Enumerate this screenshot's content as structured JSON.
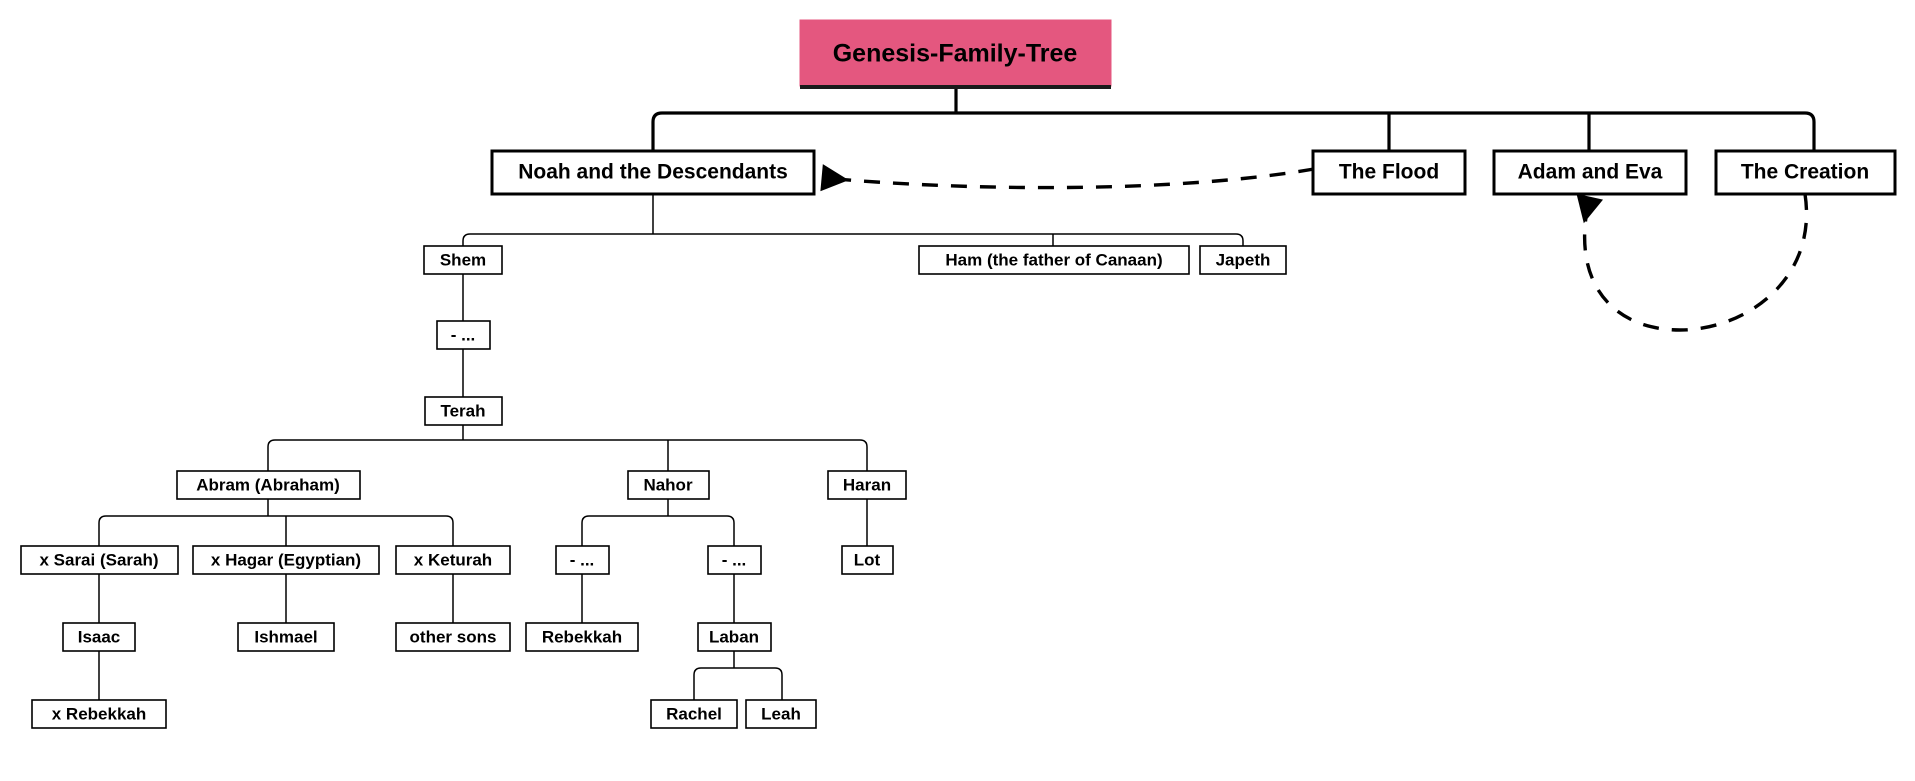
{
  "diagram": {
    "type": "family-tree",
    "title": "Genesis-Family-Tree",
    "background_color": "#ffffff",
    "title_fill_color": "#e4577f",
    "node_fill_color": "#ffffff",
    "node_stroke_color": "#000000",
    "nodes": {
      "root": "Genesis-Family-Tree",
      "noah": "Noah and the Descendants",
      "flood": "The Flood",
      "adam": "Adam and Eva",
      "creation": "The Creation",
      "shem": "Shem",
      "ham": "Ham (the father of Canaan)",
      "japeth": "Japeth",
      "shem_ellipsis": "- ...",
      "terah": "Terah",
      "abram": "Abram (Abraham)",
      "nahor": "Nahor",
      "haran": "Haran",
      "sarai": "x Sarai (Sarah)",
      "hagar": "x Hagar (Egyptian)",
      "keturah": "x Keturah",
      "nahor_ellipsis_1": "- ...",
      "nahor_ellipsis_2": "- ...",
      "lot": "Lot",
      "isaac": "Isaac",
      "ishmael": "Ishmael",
      "other_sons": "other sons",
      "rebekkah": "Rebekkah",
      "laban": "Laban",
      "x_rebekkah": "x Rebekkah",
      "rachel": "Rachel",
      "leah": "Leah"
    },
    "relations": [
      {
        "from": "root",
        "to": "noah",
        "style": "solid"
      },
      {
        "from": "root",
        "to": "flood",
        "style": "solid"
      },
      {
        "from": "root",
        "to": "adam",
        "style": "solid"
      },
      {
        "from": "root",
        "to": "creation",
        "style": "solid"
      },
      {
        "from": "flood",
        "to": "noah",
        "style": "dashed-arrow"
      },
      {
        "from": "creation",
        "to": "adam",
        "style": "dashed-arrow"
      },
      {
        "from": "noah",
        "to": "shem",
        "style": "solid"
      },
      {
        "from": "noah",
        "to": "ham",
        "style": "solid"
      },
      {
        "from": "noah",
        "to": "japeth",
        "style": "solid"
      },
      {
        "from": "shem",
        "to": "shem_ellipsis",
        "style": "solid"
      },
      {
        "from": "shem_ellipsis",
        "to": "terah",
        "style": "solid"
      },
      {
        "from": "terah",
        "to": "abram",
        "style": "solid"
      },
      {
        "from": "terah",
        "to": "nahor",
        "style": "solid"
      },
      {
        "from": "terah",
        "to": "haran",
        "style": "solid"
      },
      {
        "from": "abram",
        "to": "sarai",
        "style": "solid"
      },
      {
        "from": "abram",
        "to": "hagar",
        "style": "solid"
      },
      {
        "from": "abram",
        "to": "keturah",
        "style": "solid"
      },
      {
        "from": "nahor",
        "to": "nahor_ellipsis_1",
        "style": "solid"
      },
      {
        "from": "nahor",
        "to": "nahor_ellipsis_2",
        "style": "solid"
      },
      {
        "from": "haran",
        "to": "lot",
        "style": "solid"
      },
      {
        "from": "sarai",
        "to": "isaac",
        "style": "solid"
      },
      {
        "from": "hagar",
        "to": "ishmael",
        "style": "solid"
      },
      {
        "from": "keturah",
        "to": "other_sons",
        "style": "solid"
      },
      {
        "from": "nahor_ellipsis_1",
        "to": "rebekkah",
        "style": "solid"
      },
      {
        "from": "nahor_ellipsis_2",
        "to": "laban",
        "style": "solid"
      },
      {
        "from": "isaac",
        "to": "x_rebekkah",
        "style": "solid"
      },
      {
        "from": "laban",
        "to": "rachel",
        "style": "solid"
      },
      {
        "from": "laban",
        "to": "leah",
        "style": "solid"
      }
    ]
  }
}
